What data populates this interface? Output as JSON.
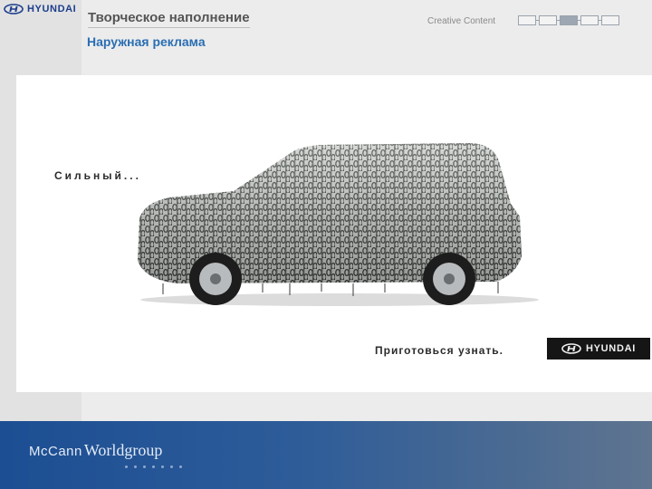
{
  "header": {
    "brand": "HYUNDAI",
    "title": "Творческое наполнение",
    "subtitle": "Наружная реклама",
    "breadcrumb_label": "Creative Content",
    "steps_total": 5,
    "active_step": 3
  },
  "ad": {
    "tagline": "Сильный...",
    "cta": "Приготовься узнать.",
    "brand": "HYUNDAI"
  },
  "footer": {
    "agency_mc": "McCann",
    "agency_wg": "Worldgroup"
  },
  "colors": {
    "subtitle": "#2a6eb3",
    "brand_blue": "#1c3e8c",
    "footer_blue": "#1c4e93"
  }
}
